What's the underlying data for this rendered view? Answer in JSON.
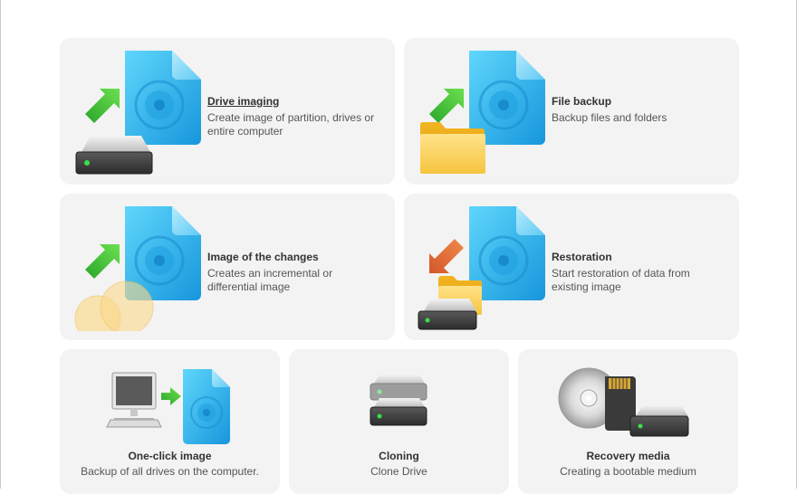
{
  "tiles": [
    {
      "title": "Drive imaging",
      "description": "Create image of partition, drives or entire computer"
    },
    {
      "title": "File backup",
      "description": "Backup files and folders"
    },
    {
      "title": "Image of the changes",
      "description": "Creates an incremental or differential image"
    },
    {
      "title": "Restoration",
      "description": "Start restoration of data from existing image"
    },
    {
      "title": "One-click image",
      "description": "Backup of all drives on the computer."
    },
    {
      "title": "Cloning",
      "description": "Clone Drive"
    },
    {
      "title": "Recovery media",
      "description": "Creating a bootable medium"
    }
  ],
  "icons": {
    "drive_imaging": [
      "disk-image-icon",
      "green-arrow-icon",
      "hard-drive-icon"
    ],
    "file_backup": [
      "disk-image-icon",
      "green-arrow-icon",
      "folder-icon"
    ],
    "image_changes": [
      "disk-image-icon",
      "green-arrow-icon",
      "overlapping-circles-icon"
    ],
    "restoration": [
      "disk-image-icon",
      "orange-arrow-icon",
      "folder-icon",
      "hard-drive-icon"
    ],
    "one_click": [
      "computer-icon",
      "green-arrow-icon",
      "disk-image-icon"
    ],
    "cloning": [
      "hard-drive-icon",
      "hard-drive-icon"
    ],
    "recovery_media": [
      "cd-icon",
      "sd-card-icon",
      "hard-drive-icon"
    ]
  },
  "colors": {
    "tile_background": "#f3f3f3",
    "accent_blue": "#29b6f0",
    "arrow_green": "#3cc23c",
    "arrow_orange": "#e2703a",
    "folder_yellow": "#f7c948"
  }
}
